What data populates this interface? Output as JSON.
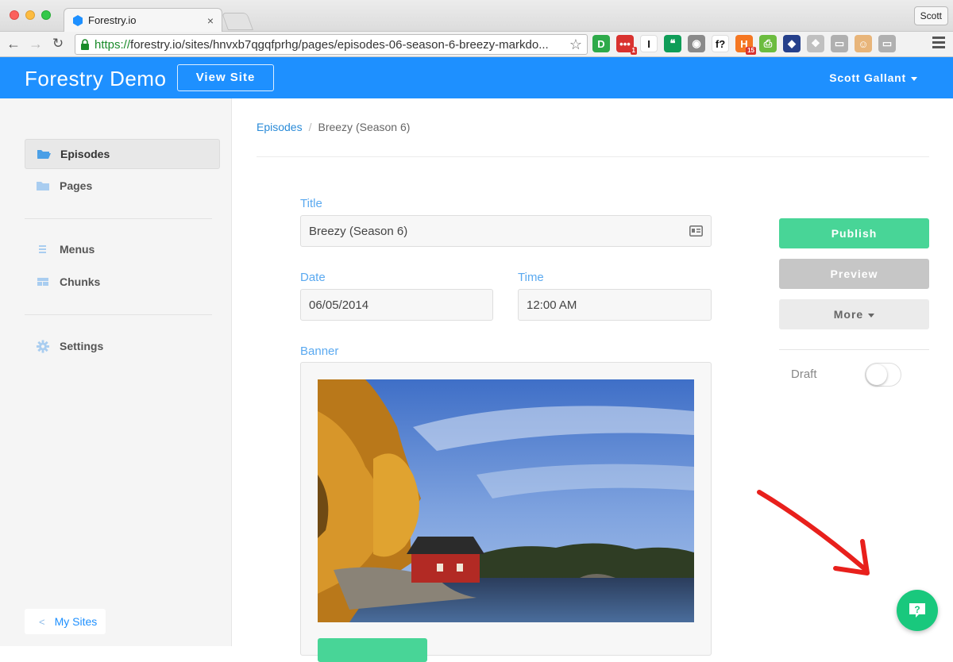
{
  "browser": {
    "tab_title": "Forestry.io",
    "tab_close": "×",
    "profile": "Scott",
    "url_https": "https://",
    "url_rest": "forestry.io/sites/hnvxb7qgqfprhg/pages/episodes-06-season-6-breezy-markdo...",
    "extensions": [
      {
        "icon": "disconnect-icon",
        "label": "D",
        "color": "#2eaa4a"
      },
      {
        "icon": "lastpass-icon",
        "label": "•••",
        "color": "#d9322f",
        "badge": "1"
      },
      {
        "icon": "instapaper-icon",
        "label": "I",
        "color": "#ffffff"
      },
      {
        "icon": "hangouts-icon",
        "label": "❝",
        "color": "#0f9d58"
      },
      {
        "icon": "camera-icon",
        "label": "◉",
        "color": "#8a8a8a"
      },
      {
        "icon": "whatfont-icon",
        "label": "f?",
        "color": "#ffffff"
      },
      {
        "icon": "hubspot-icon",
        "label": "H",
        "color": "#f57722",
        "badge": "15"
      },
      {
        "icon": "print-icon",
        "label": "⎙",
        "color": "#6cbc3f"
      },
      {
        "icon": "colorzilla-icon",
        "label": "◆",
        "color": "#26408b"
      },
      {
        "icon": "dropbox-icon",
        "label": "❖",
        "color": "#c0c0c0"
      },
      {
        "icon": "screenshot-icon",
        "label": "▭",
        "color": "#b0b0b0"
      },
      {
        "icon": "avatar-ext-icon",
        "label": "☺",
        "color": "#e8b57a"
      },
      {
        "icon": "cast-icon",
        "label": "▭",
        "color": "#b0b0b0"
      }
    ]
  },
  "header": {
    "brand": "Forestry Demo",
    "view_site": "View Site",
    "user": "Scott Gallant",
    "color": "#1e90ff"
  },
  "sidebar": {
    "items": [
      {
        "label": "Episodes",
        "icon": "folder-open-icon",
        "active": true
      },
      {
        "label": "Pages",
        "icon": "folder-icon",
        "active": false
      },
      {
        "label": "Menus",
        "icon": "list-icon",
        "active": false
      },
      {
        "label": "Chunks",
        "icon": "chunks-icon",
        "active": false
      },
      {
        "label": "Settings",
        "icon": "gear-icon",
        "active": false
      }
    ],
    "my_sites": "My Sites"
  },
  "breadcrumb": {
    "parent": "Episodes",
    "separator": "/",
    "current": "Breezy (Season 6)"
  },
  "form": {
    "title_label": "Title",
    "title_value": "Breezy (Season 6)",
    "date_label": "Date",
    "date_value": "06/05/2014",
    "time_label": "Time",
    "time_value": "12:00 AM",
    "banner_label": "Banner"
  },
  "actions": {
    "publish": "Publish",
    "preview": "Preview",
    "more": "More",
    "draft_label": "Draft",
    "draft_enabled": false,
    "publish_color": "#48d597"
  },
  "help": {
    "icon": "help-chat-icon",
    "color": "#19c87d"
  }
}
